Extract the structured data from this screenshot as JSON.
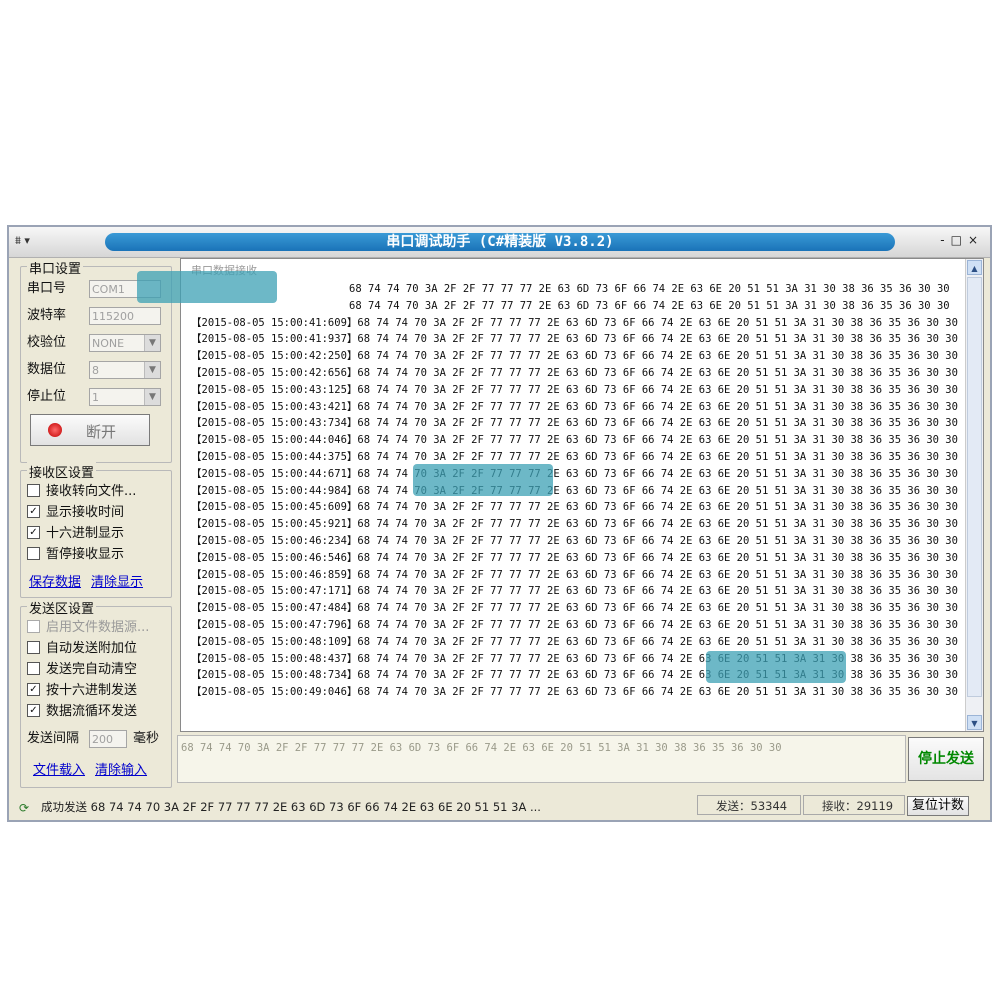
{
  "window": {
    "title": "串口调试助手 (C#精装版 V3.8.2)",
    "min": "-",
    "max": "□",
    "close": "×"
  },
  "serial": {
    "group_title": "串口设置",
    "port_label": "串口号",
    "port_value": "COM1",
    "baud_label": "波特率",
    "baud_value": "115200",
    "parity_label": "校验位",
    "parity_value": "NONE",
    "databits_label": "数据位",
    "databits_value": "8",
    "stopbits_label": "停止位",
    "stopbits_value": "1",
    "connect_button": "断开"
  },
  "receive": {
    "group_title": "接收区设置",
    "options": [
      {
        "label": "接收转向文件...",
        "checked": false
      },
      {
        "label": "显示接收时间",
        "checked": true
      },
      {
        "label": "十六进制显示",
        "checked": true
      },
      {
        "label": "暂停接收显示",
        "checked": false
      }
    ],
    "save_link": "保存数据",
    "clear_link": "清除显示"
  },
  "send": {
    "group_title": "发送区设置",
    "options": [
      {
        "label": "启用文件数据源...",
        "checked": false
      },
      {
        "label": "自动发送附加位",
        "checked": false
      },
      {
        "label": "发送完自动清空",
        "checked": false
      },
      {
        "label": "按十六进制发送",
        "checked": true
      },
      {
        "label": "数据流循环发送",
        "checked": true
      }
    ],
    "interval_label": "发送间隔",
    "interval_value": "200",
    "interval_unit": "毫秒",
    "load_file_link": "文件载入",
    "clear_input_link": "清除输入",
    "input_text": "68 74 74 70 3A 2F 2F 77 77 77 2E 63 6D 73 6F 66 74 2E 63 6E 20 51 51 3A 31 30 38 36 35 36 30 30",
    "stop_button": "停止发送"
  },
  "recv_area": {
    "header": "串口数据接收",
    "payload": "68 74 74 70 3A 2F 2F 77 77 77 2E 63 6D 73 6F 66 74 2E 63 6E 20 51 51 3A 31 30 38 36 35 36 30 30",
    "timestamps": [
      "",
      "",
      "2015-08-05 15:00:41:609",
      "2015-08-05 15:00:41:937",
      "2015-08-05 15:00:42:250",
      "2015-08-05 15:00:42:656",
      "2015-08-05 15:00:43:125",
      "2015-08-05 15:00:43:421",
      "2015-08-05 15:00:43:734",
      "2015-08-05 15:00:44:046",
      "2015-08-05 15:00:44:375",
      "2015-08-05 15:00:44:671",
      "2015-08-05 15:00:44:984",
      "2015-08-05 15:00:45:609",
      "2015-08-05 15:00:45:921",
      "2015-08-05 15:00:46:234",
      "2015-08-05 15:00:46:546",
      "2015-08-05 15:00:46:859",
      "2015-08-05 15:00:47:171",
      "2015-08-05 15:00:47:484",
      "2015-08-05 15:00:47:796",
      "2015-08-05 15:00:48:109",
      "2015-08-05 15:00:48:437",
      "2015-08-05 15:00:48:734",
      "2015-08-05 15:00:49:046"
    ]
  },
  "status": {
    "message": "成功发送 68 74 74 70 3A 2F 2F 77 77 77 2E 63 6D 73 6F 66 74 2E 63 6E 20 51 51 3A ...",
    "sent": "发送：53344",
    "received": "接收：29119",
    "reset_button": "复位计数"
  }
}
